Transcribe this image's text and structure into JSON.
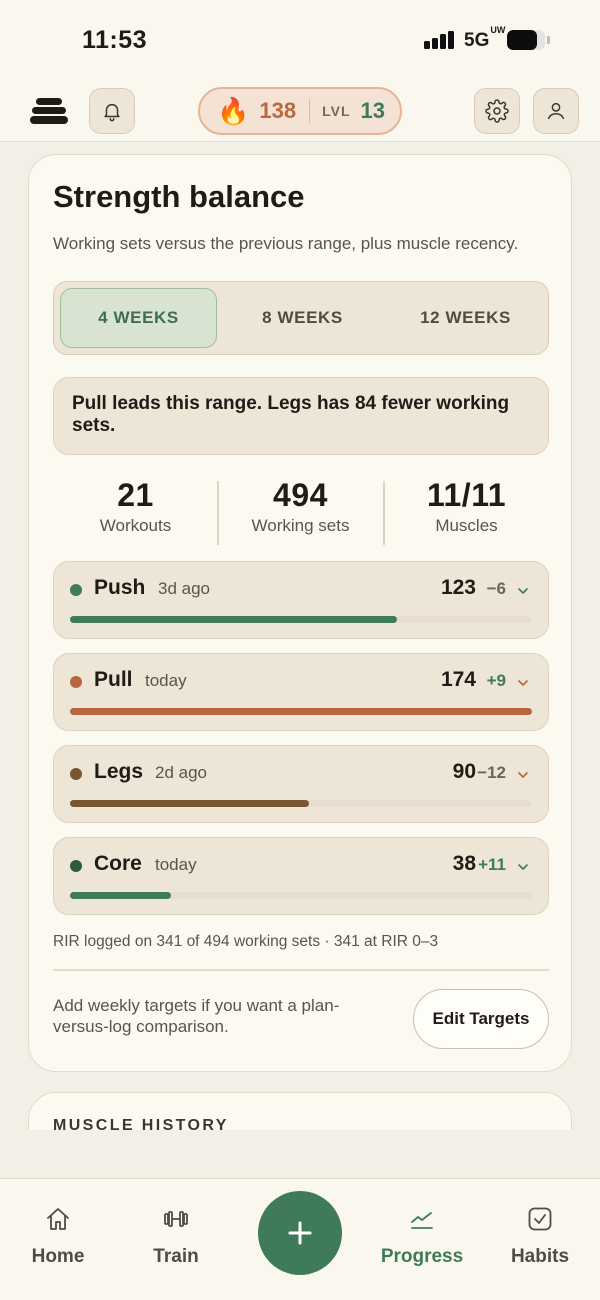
{
  "status_bar": {
    "time": "11:53",
    "network": "5G",
    "network_suffix": "UW",
    "battery_level": 0.78
  },
  "header": {
    "icons": {
      "logo": "stacked-discs-logo",
      "notifications": "bell-icon",
      "settings": "gear-icon",
      "profile": "person-icon"
    },
    "streak": {
      "icon": "fire-emoji",
      "value": "138"
    },
    "level": {
      "label": "LVL",
      "value": "13"
    }
  },
  "card": {
    "title": "Strength balance",
    "subtitle": "Working sets versus the previous range, plus muscle recency.",
    "ranges": [
      {
        "label": "4 WEEKS",
        "active": true
      },
      {
        "label": "8 WEEKS",
        "active": false
      },
      {
        "label": "12 WEEKS",
        "active": false
      }
    ],
    "summary": "Pull leads this range. Legs has 84 fewer working sets.",
    "stats": [
      {
        "value": "21",
        "label": "Workouts"
      },
      {
        "value": "494",
        "label": "Working sets"
      },
      {
        "value": "11/11",
        "label": "Muscles"
      }
    ],
    "groups": [
      {
        "name": "Push",
        "recency": "3d ago",
        "count": "123",
        "delta": "−6",
        "delta_color": "#6a655a",
        "dot_color": "#3f7b59",
        "bar_color": "#3f7b59",
        "fill": 0.707,
        "chevron_color": "#3f7b59"
      },
      {
        "name": "Pull",
        "recency": "today",
        "count": "174",
        "delta": "+9",
        "delta_color": "#3f7b59",
        "dot_color": "#b8653e",
        "bar_color": "#b8653e",
        "fill": 1.0,
        "chevron_color": "#b8653e"
      },
      {
        "name": "Legs",
        "recency": "2d ago",
        "count": "90",
        "delta": "−12",
        "delta_color": "#6a655a",
        "dot_color": "#7a5530",
        "bar_color": "#7a5530",
        "fill": 0.517,
        "chevron_color": "#b8653e"
      },
      {
        "name": "Core",
        "recency": "today",
        "count": "38",
        "delta": "+11",
        "delta_color": "#3f7b59",
        "dot_color": "#2f5a3e",
        "bar_color": "#3f7b59",
        "fill": 0.218,
        "chevron_color": "#3f7b59"
      }
    ],
    "rir_note": "RIR logged on 341 of 494 working sets · 341 at RIR 0–3",
    "targets_note": "Add weekly targets if you want a plan-versus-log comparison.",
    "edit_targets_label": "Edit Targets"
  },
  "card2": {
    "title": "MUSCLE HISTORY"
  },
  "nav": {
    "items": [
      {
        "label": "Home",
        "icon": "home-icon",
        "active": false
      },
      {
        "label": "Train",
        "icon": "dumbbell-icon",
        "active": false
      },
      {
        "label": "Progress",
        "icon": "trend-chart-icon",
        "active": true
      },
      {
        "label": "Habits",
        "icon": "checkbox-icon",
        "active": false
      }
    ],
    "add_icon": "plus-icon"
  },
  "colors": {
    "accent_green": "#3f7b59",
    "accent_orange": "#b8653e",
    "background": "#f2efe6",
    "card": "#fcf9f1"
  }
}
